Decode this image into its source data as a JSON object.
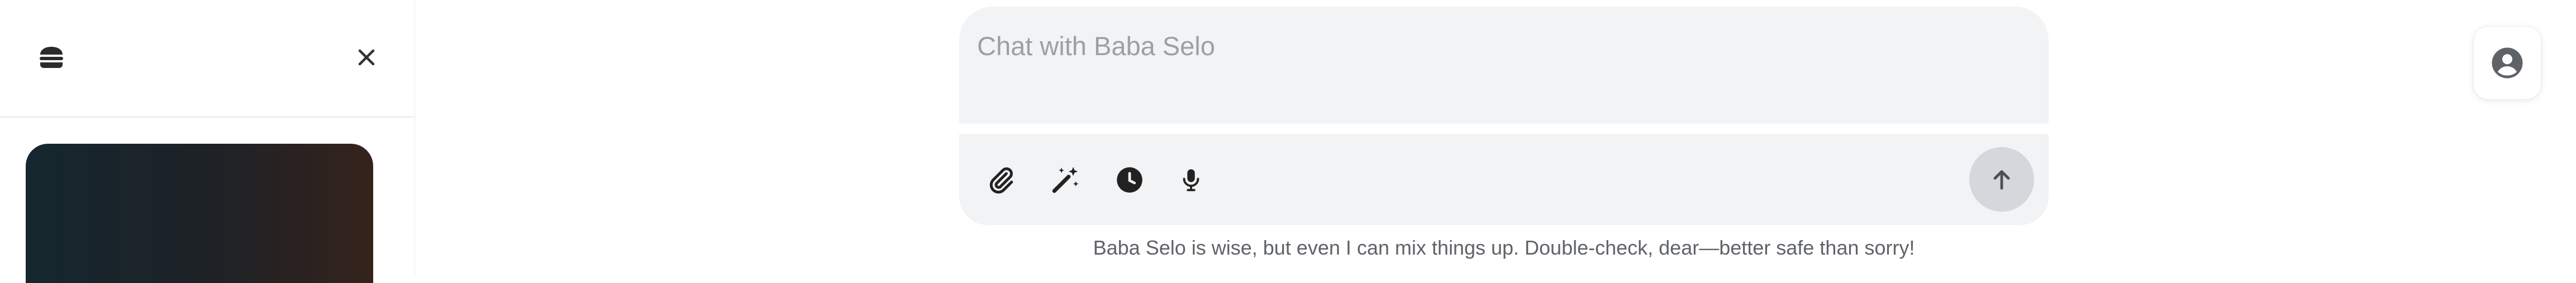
{
  "colors": {
    "composer_bg": "#f2f3f5",
    "send_button_bg": "#d4d7db",
    "icon_dark": "#222222",
    "disclaimer_text": "#5f6368",
    "placeholder_text": "#9aa0a6"
  },
  "sidebar": {
    "menu_icon": "burger-icon",
    "close_icon": "close-icon"
  },
  "composer": {
    "placeholder": "Chat with Baba Selo",
    "value": "",
    "tools": [
      {
        "icon": "paperclip-icon"
      },
      {
        "icon": "magic-wand-icon"
      },
      {
        "icon": "clock-icon"
      },
      {
        "icon": "microphone-icon"
      }
    ],
    "send_icon": "arrow-up-icon"
  },
  "disclaimer": "Baba Selo is wise, but even I can mix things up. Double-check, dear—better safe than sorry!",
  "account": {
    "icon": "user-circle-icon"
  }
}
